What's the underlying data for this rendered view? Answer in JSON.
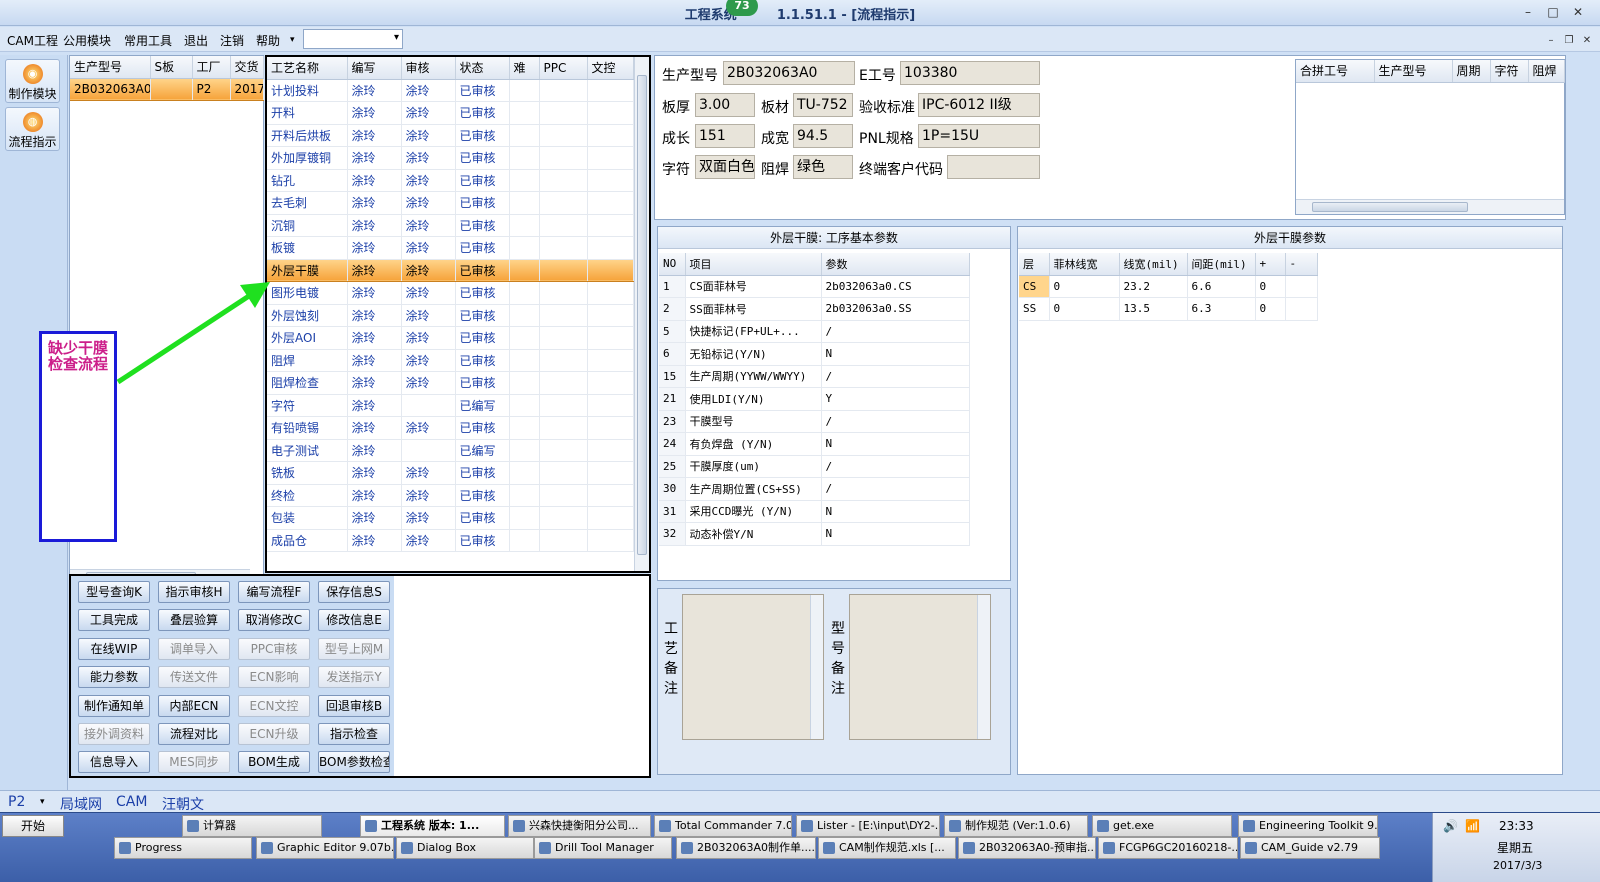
{
  "window": {
    "title": "工程系统",
    "version": "1.1.51.1 - [流程指示]",
    "badge": "73"
  },
  "menu": {
    "items": [
      "CAM工程",
      "公用模块",
      "常用工具",
      "退出",
      "注销",
      "帮助"
    ],
    "combo_value": ""
  },
  "nav": {
    "items": [
      {
        "label": "制作模块",
        "icon": "wheel-icon"
      },
      {
        "label": "流程指示",
        "icon": "flow-icon"
      }
    ]
  },
  "model_list": {
    "headers": [
      "生产型号",
      "S板",
      "工厂",
      "交货"
    ],
    "rows": [
      [
        "2B032063A0",
        "",
        "P2",
        "2017"
      ]
    ]
  },
  "process_list": {
    "headers": [
      "工艺名称",
      "编写",
      "审核",
      "状态",
      "难",
      "PPC",
      "文控"
    ],
    "rows": [
      [
        "计划投料",
        "涂玲",
        "涂玲",
        "已审核"
      ],
      [
        "开料",
        "涂玲",
        "涂玲",
        "已审核"
      ],
      [
        "开料后烘板",
        "涂玲",
        "涂玲",
        "已审核"
      ],
      [
        "外加厚镀铜",
        "涂玲",
        "涂玲",
        "已审核"
      ],
      [
        "钻孔",
        "涂玲",
        "涂玲",
        "已审核"
      ],
      [
        "去毛刺",
        "涂玲",
        "涂玲",
        "已审核"
      ],
      [
        "沉铜",
        "涂玲",
        "涂玲",
        "已审核"
      ],
      [
        "板镀",
        "涂玲",
        "涂玲",
        "已审核"
      ],
      [
        "外层干膜",
        "涂玲",
        "涂玲",
        "已审核"
      ],
      [
        "图形电镀",
        "涂玲",
        "涂玲",
        "已审核"
      ],
      [
        "外层蚀刻",
        "涂玲",
        "涂玲",
        "已审核"
      ],
      [
        "外层AOI",
        "涂玲",
        "涂玲",
        "已审核"
      ],
      [
        "阻焊",
        "涂玲",
        "涂玲",
        "已审核"
      ],
      [
        "阻焊检查",
        "涂玲",
        "涂玲",
        "已审核"
      ],
      [
        "字符",
        "涂玲",
        "",
        "已编写"
      ],
      [
        "有铅喷锡",
        "涂玲",
        "涂玲",
        "已审核"
      ],
      [
        "电子测试",
        "涂玲",
        "",
        "已编写"
      ],
      [
        "铣板",
        "涂玲",
        "涂玲",
        "已审核"
      ],
      [
        "终检",
        "涂玲",
        "涂玲",
        "已审核"
      ],
      [
        "包装",
        "涂玲",
        "涂玲",
        "已审核"
      ],
      [
        "成品仓",
        "涂玲",
        "涂玲",
        "已审核"
      ]
    ],
    "selected_index": 8
  },
  "annotation": {
    "text": "缺少干膜检查流程"
  },
  "buttons": [
    [
      "型号查询K",
      "指示审核H",
      "编写流程F",
      "保存信息S"
    ],
    [
      "工具完成",
      "叠层验算",
      "取消修改C",
      "修改信息E"
    ],
    [
      "在线WIP",
      "调单导入",
      "PPC审核",
      "型号上网M"
    ],
    [
      "能力参数",
      "传送文件",
      "ECN影响",
      "发送指示Y"
    ],
    [
      "制作通知单",
      "内部ECN",
      "ECN文控",
      "回退审核B"
    ],
    [
      "接外调资料",
      "流程对比",
      "ECN升级",
      "指示检查"
    ],
    [
      "信息导入",
      "MES同步",
      "BOM生成",
      "BOM参数检查"
    ]
  ],
  "buttons_disabled": [
    [
      false,
      false,
      false,
      false
    ],
    [
      false,
      false,
      false,
      false
    ],
    [
      false,
      true,
      true,
      true
    ],
    [
      false,
      true,
      true,
      true
    ],
    [
      false,
      false,
      true,
      false
    ],
    [
      true,
      false,
      true,
      false
    ],
    [
      false,
      true,
      false,
      false
    ]
  ],
  "info": {
    "model_label": "生产型号",
    "model_value": "2B032063A0",
    "e_label": "E工号",
    "e_value": "103380",
    "thick_label": "板厚",
    "thick_value": "3.00",
    "mat_label": "板材",
    "mat_value": "TU-752",
    "std_label": "验收标准",
    "std_value": "IPC-6012 II级",
    "len_label": "成长",
    "len_value": "151",
    "wid_label": "成宽",
    "wid_value": "94.5",
    "pnl_label": "PNL规格",
    "pnl_value": "1P=15U",
    "char_label": "字符",
    "char_value": "双面白色",
    "mask_label": "阻焊",
    "mask_value": "绿色",
    "cust_label": "终端客户代码",
    "cust_value": ""
  },
  "panel_list": {
    "headers": [
      "合拼工号",
      "生产型号",
      "周期",
      "字符",
      "阻焊"
    ]
  },
  "basic_params": {
    "title": "外层干膜: 工序基本参数",
    "headers": [
      "NO",
      "项目",
      "参数"
    ],
    "rows": [
      [
        "1",
        "CS面菲林号",
        "2b032063a0.CS"
      ],
      [
        "2",
        "SS面菲林号",
        "2b032063a0.SS"
      ],
      [
        "5",
        "快捷标记(FP+UL+...",
        "/"
      ],
      [
        "6",
        "无铅标记(Y/N)",
        "N"
      ],
      [
        "15",
        "生产周期(YYWW/WWYY)",
        "/"
      ],
      [
        "21",
        "使用LDI(Y/N)",
        "Y"
      ],
      [
        "23",
        "干膜型号",
        "/"
      ],
      [
        "24",
        "有负焊盘 (Y/N)",
        "N"
      ],
      [
        "25",
        "干膜厚度(um)",
        "/"
      ],
      [
        "30",
        "生产周期位置(CS+SS)",
        "/"
      ],
      [
        "31",
        "采用CCD曝光 (Y/N)",
        "N"
      ],
      [
        "32",
        "动态补偿Y/N",
        "N"
      ]
    ]
  },
  "film_params": {
    "title": "外层干膜参数",
    "headers": [
      "层",
      "菲林线宽",
      "线宽(mil)",
      "间距(mil)",
      "+",
      "-"
    ],
    "rows": [
      [
        "CS",
        "0",
        "23.2",
        "6.6",
        "0",
        ""
      ],
      [
        "SS",
        "0",
        "13.5",
        "6.3",
        "0",
        ""
      ]
    ]
  },
  "notes": {
    "process_label": "工艺备注",
    "model_label": "型号备注"
  },
  "status": {
    "combo": "P2",
    "items": [
      "局域网",
      "CAM",
      "汪朝文"
    ]
  },
  "taskbar": {
    "start": "开始",
    "row1": [
      "计算器",
      "工程系统  版本: 1...",
      "兴森快捷衡阳分公司...",
      "Total Commander 7.0 ...",
      "Lister - [E:\\input\\DY2-...",
      "制作规范 (Ver:1.0.6)",
      "get.exe",
      "Engineering Toolkit 9...."
    ],
    "row2": [
      "Progress",
      "Graphic Editor 9.07b...",
      "Dialog Box",
      "Drill Tool Manager",
      "2B032063A0制作单....",
      "CAM制作规范.xls [...",
      "2B032063A0-预审指...",
      "FCGP6GC20160218-...",
      "CAM_Guide v2.79"
    ],
    "clock": "23:33",
    "weekday": "星期五",
    "date": "2017/3/3"
  },
  "colors": {
    "accent": "#f6a33a",
    "link": "#1b3fa8",
    "annotation_arrow": "#1fe01f",
    "annotation_border": "#1a1ad8",
    "annotation_text": "#cc1f8a"
  }
}
